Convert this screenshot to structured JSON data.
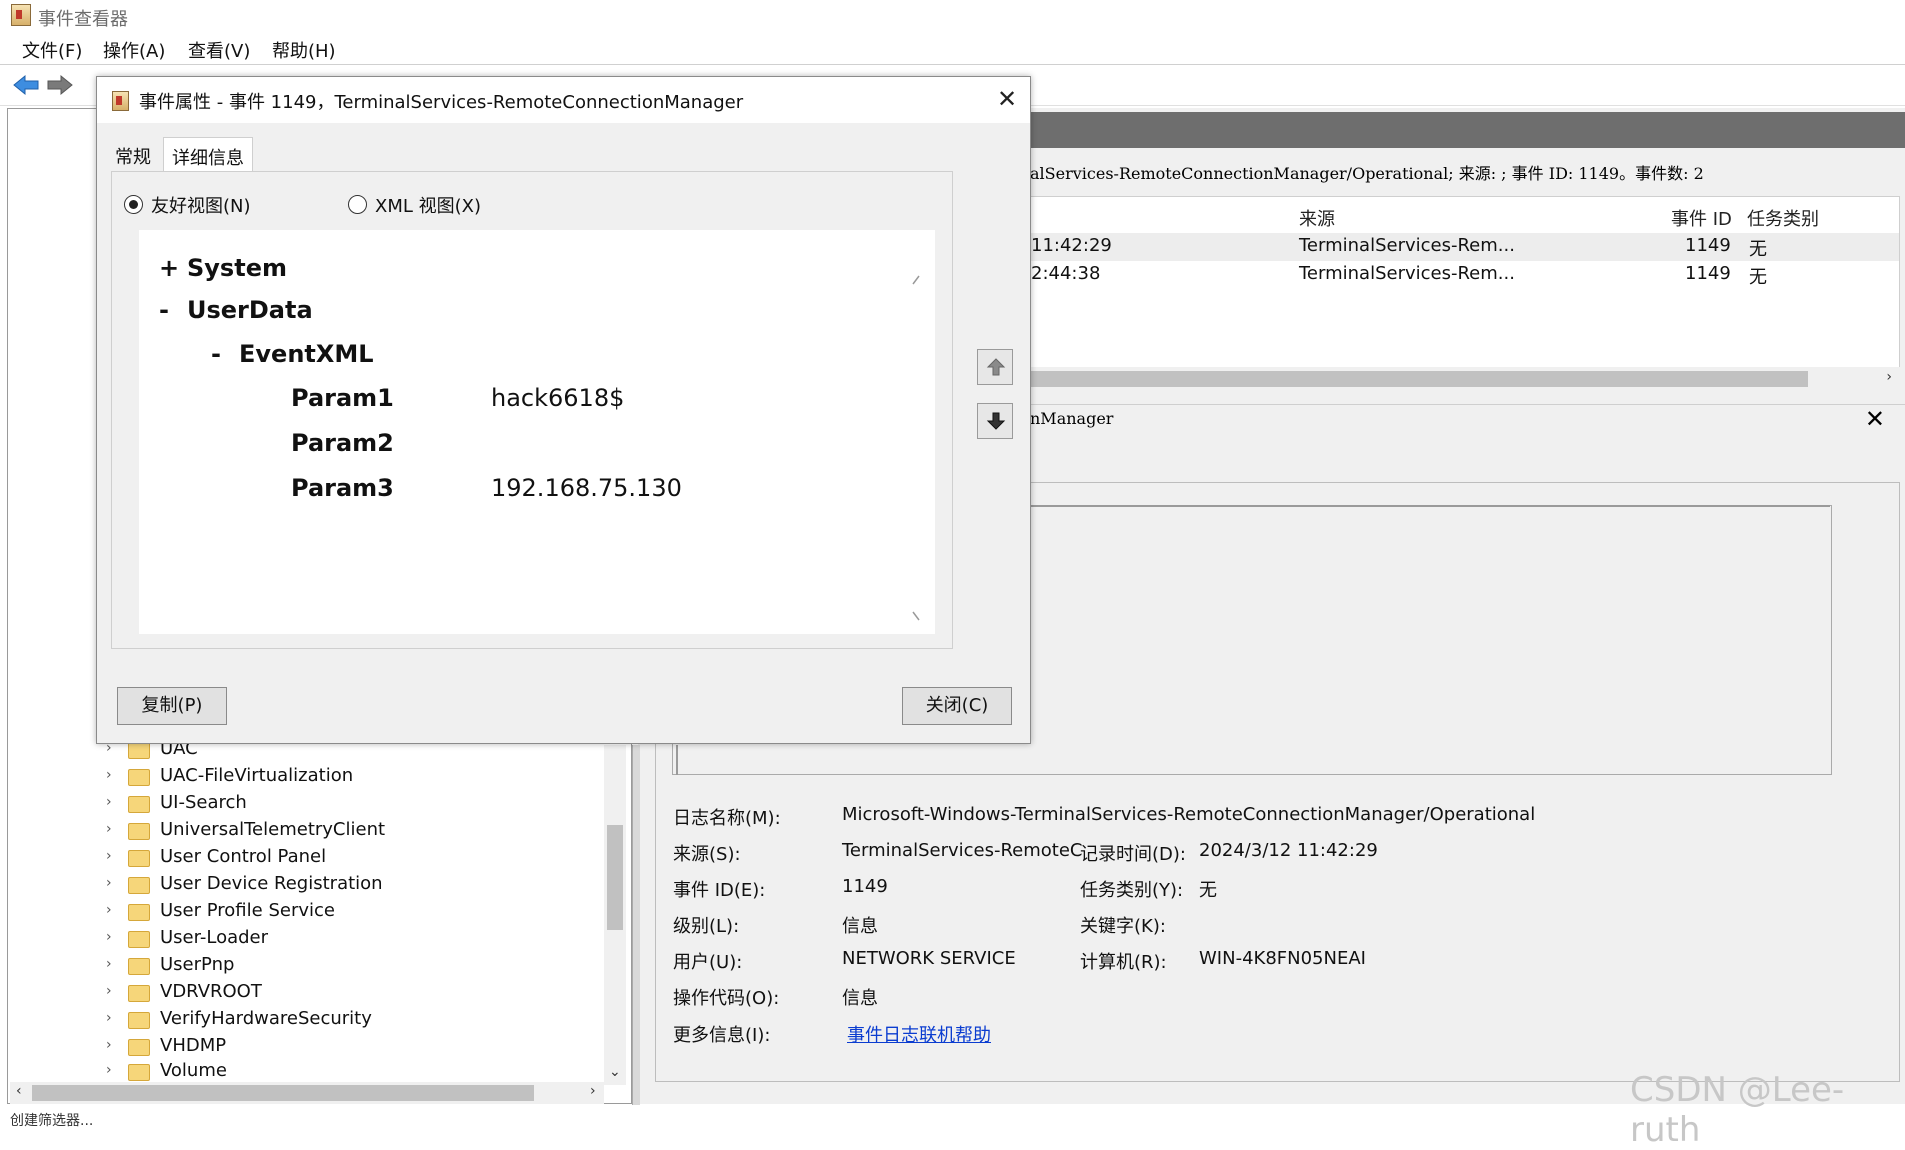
{
  "app": {
    "title": "事件查看器"
  },
  "menu": [
    "文件(F)",
    "操作(A)",
    "查看(V)",
    "帮助(H)"
  ],
  "log_info_line": "alServices-RemoteConnectionManager/Operational; 来源: ; 事件 ID: 1149。事件数: 2",
  "event_list": {
    "columns": [
      "来源",
      "事件 ID",
      "任务类别"
    ],
    "rows": [
      {
        "time": "11:42:29",
        "source": "TerminalServices-Rem...",
        "event_id": "1149",
        "task": "无"
      },
      {
        "time": "2:44:38",
        "source": "TerminalServices-Rem...",
        "event_id": "1149",
        "task": "无"
      }
    ]
  },
  "detail_header": "nManager",
  "detail": {
    "log_name_label": "日志名称(M):",
    "log_name": "Microsoft-Windows-TerminalServices-RemoteConnectionManager/Operational",
    "source_label": "来源(S):",
    "source": "TerminalServices-RemoteC",
    "logged_label": "记录时间(D):",
    "logged": "2024/3/12 11:42:29",
    "event_id_label": "事件 ID(E):",
    "event_id": "1149",
    "task_label": "任务类别(Y):",
    "task": "无",
    "level_label": "级别(L):",
    "level": "信息",
    "keywords_label": "关键字(K):",
    "user_label": "用户(U):",
    "user": "NETWORK SERVICE",
    "computer_label": "计算机(R):",
    "computer": "WIN-4K8FN05NEAI",
    "opcode_label": "操作代码(O):",
    "opcode": "信息",
    "more_info_label": "更多信息(I):",
    "more_info_link": "事件日志联机帮助"
  },
  "tree_items": [
    "UAC",
    "UAC-FileVirtualization",
    "UI-Search",
    "UniversalTelemetryClient",
    "User Control Panel",
    "User Device Registration",
    "User Profile Service",
    "User-Loader",
    "UserPnp",
    "VDRVROOT",
    "VerifyHardwareSecurity",
    "VHDMP",
    "Volume"
  ],
  "dialog": {
    "title": "事件属性 - 事件 1149，TerminalServices-RemoteConnectionManager",
    "tabs": [
      "常规",
      "详细信息"
    ],
    "radio_friendly": "友好视图(N)",
    "radio_xml": "XML 视图(X)",
    "xml_tree": {
      "system": "System",
      "userdata": "UserData",
      "eventxml": "EventXML",
      "params": [
        {
          "name": "Param1",
          "value": "hack6618$"
        },
        {
          "name": "Param2",
          "value": ""
        },
        {
          "name": "Param3",
          "value": "192.168.75.130"
        }
      ]
    },
    "copy_button": "复制(P)",
    "close_button": "关闭(C)"
  },
  "watermark": "CSDN @Lee-ruth",
  "status_text": "创建筛选器..."
}
